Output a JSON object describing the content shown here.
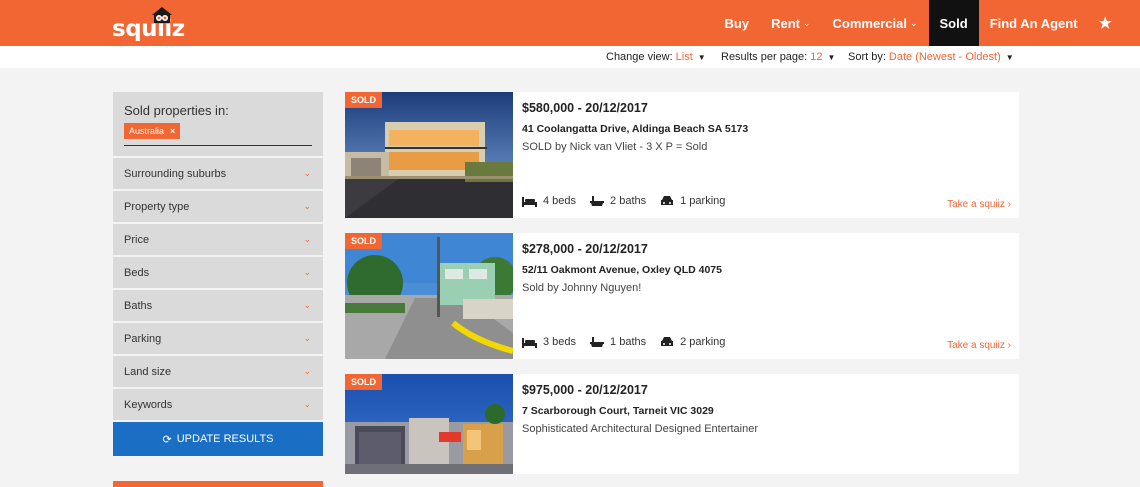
{
  "brand": {
    "logo_text": "squiiz",
    "accent": "#f26633",
    "dark": "#111111",
    "button_blue": "#1a6fc4"
  },
  "nav": {
    "items": [
      {
        "label": "Buy",
        "has_dropdown": false,
        "active": false
      },
      {
        "label": "Rent",
        "has_dropdown": true,
        "active": false
      },
      {
        "label": "Commercial",
        "has_dropdown": true,
        "active": false
      },
      {
        "label": "Sold",
        "has_dropdown": false,
        "active": true
      },
      {
        "label": "Find An Agent",
        "has_dropdown": false,
        "active": false
      }
    ],
    "favourites_icon": "star-icon"
  },
  "sortbar": {
    "view_label": "Change view:",
    "view_value": "List",
    "per_page_label": "Results per page:",
    "per_page_value": "12",
    "sort_label": "Sort by:",
    "sort_value": "Date (Newest - Oldest)"
  },
  "sidebar": {
    "sold_in_title": "Sold properties in:",
    "tag": "Australia",
    "tag_remove": "×",
    "filters": [
      "Surrounding suburbs",
      "Property type",
      "Price",
      "Beds",
      "Baths",
      "Parking",
      "Land size",
      "Keywords"
    ],
    "update_label": "UPDATE RESULTS"
  },
  "listings": [
    {
      "badge": "SOLD",
      "price": "$580,000 - 20/12/2017",
      "address": "41 Coolangatta Drive, Aldinga Beach SA 5173",
      "desc": "SOLD by Nick van Vliet - 3 X P = Sold",
      "beds": "4 beds",
      "baths": "2 baths",
      "parking": "1 parking",
      "cta": "Take a squiiz ›"
    },
    {
      "badge": "SOLD",
      "price": "$278,000 - 20/12/2017",
      "address": "52/11 Oakmont Avenue, Oxley QLD 4075",
      "desc": "Sold by Johnny Nguyen!",
      "beds": "3 beds",
      "baths": "1 baths",
      "parking": "2 parking",
      "cta": "Take a squiiz ›"
    },
    {
      "badge": "SOLD",
      "price": "$975,000 - 20/12/2017",
      "address": "7 Scarborough Court, Tarneit VIC 3029",
      "desc": "Sophisticated Architectural Designed Entertainer",
      "beds": "",
      "baths": "",
      "parking": "",
      "cta": ""
    }
  ]
}
